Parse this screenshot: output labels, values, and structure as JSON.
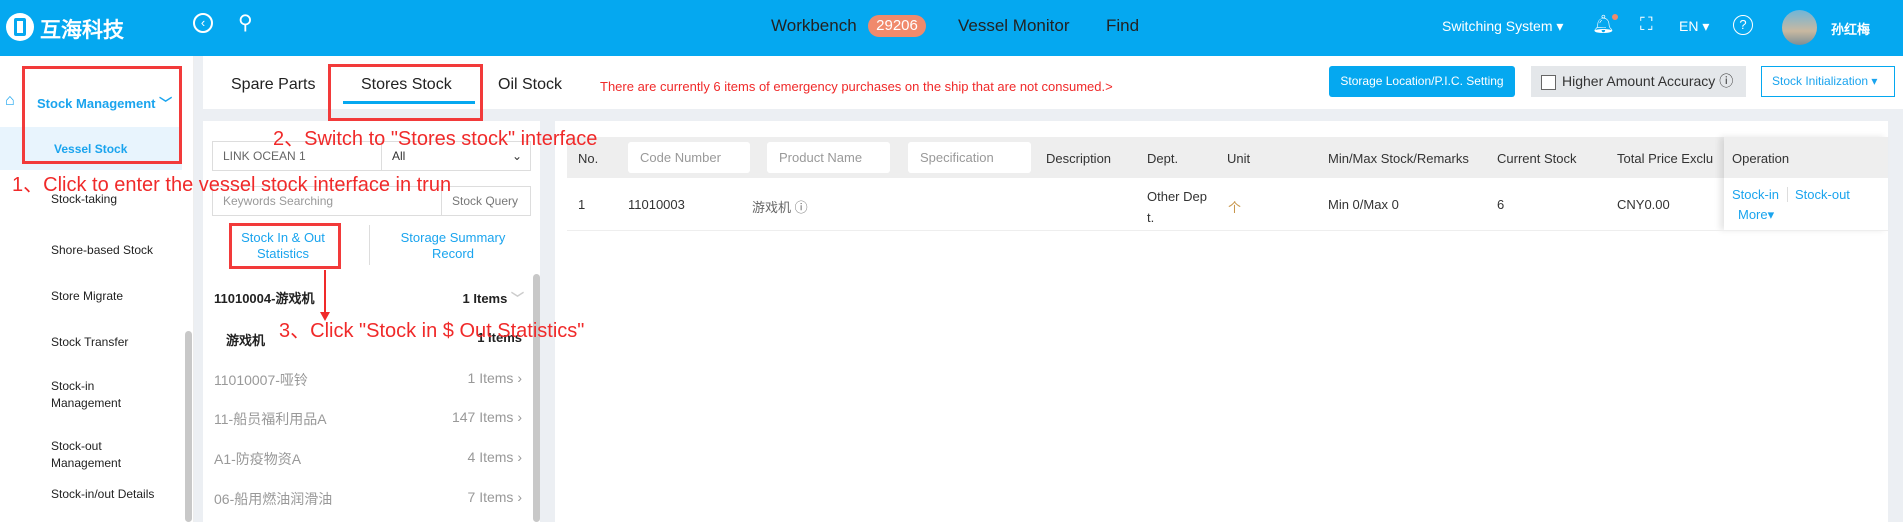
{
  "header": {
    "brand": "互海科技",
    "nav": {
      "workbench": "Workbench",
      "workbench_badge": "29206",
      "vessel_monitor": "Vessel Monitor",
      "find": "Find"
    },
    "switching_system": "Switching System",
    "language": "EN",
    "user_name": "孙红梅"
  },
  "sidebar": {
    "group": "Stock Management",
    "items": [
      {
        "label": "Vessel Stock",
        "active": true
      },
      {
        "label": "Stock-taking"
      },
      {
        "label": "Shore-based Stock"
      },
      {
        "label": "Store Migrate"
      },
      {
        "label": "Stock Transfer"
      },
      {
        "label": "Stock-in Management"
      },
      {
        "label": "Stock-out Management"
      },
      {
        "label": "Stock-in/out Details"
      }
    ]
  },
  "tabs": [
    {
      "label": "Spare Parts"
    },
    {
      "label": "Stores Stock",
      "active": true
    },
    {
      "label": "Oil Stock"
    }
  ],
  "notice": "There are currently 6 items of emergency purchases on the ship that are not consumed.>",
  "toolbar": {
    "storage_setting": "Storage Location/P.I.C. Setting",
    "higher_accuracy": "Higher Amount Accuracy",
    "stock_init": "Stock Initialization"
  },
  "left": {
    "vessel": "LINK OCEAN 1",
    "filter": "All",
    "keyword_placeholder": "Keywords Searching",
    "stock_query": "Stock Query",
    "stats_link": "Stock In & Out Statistics",
    "summary_link": "Storage Summary Record",
    "groups": [
      {
        "name": "11010004-游戏机",
        "count": "1 Items",
        "expanded": true,
        "children": [
          {
            "name": "游戏机",
            "count": "1 Items"
          }
        ]
      },
      {
        "name": "11010007-哑铃",
        "count": "1 Items"
      },
      {
        "name": "11-船员福利用品A",
        "count": "147 Items"
      },
      {
        "name": "A1-防疫物资A",
        "count": "4 Items"
      },
      {
        "name": "06-船用燃油润滑油",
        "count": "7 Items"
      }
    ]
  },
  "table": {
    "headers": {
      "no": "No.",
      "code": "Code Number",
      "product": "Product Name",
      "spec": "Specification",
      "desc": "Description",
      "dept": "Dept.",
      "unit": "Unit",
      "minmax": "Min/Max Stock/Remarks",
      "current": "Current Stock",
      "total": "Total Price Exclu",
      "operation": "Operation"
    },
    "rows": [
      {
        "no": "1",
        "code": "11010003",
        "product": "游戏机",
        "desc": "",
        "dept": "Other Dept.",
        "unit": "个",
        "minmax": "Min 0/Max 0",
        "current": "6",
        "total": "CNY0.00",
        "ops": {
          "stock_in": "Stock-in",
          "stock_out": "Stock-out",
          "more": "More"
        }
      }
    ]
  },
  "annotations": {
    "step1": "1、Click to enter the vessel stock interface in trun",
    "step2": "2、Switch to \"Stores stock\" interface",
    "step3": "3、Click \"Stock in $ Out Statistics\""
  },
  "colors": {
    "header": "#05a8f0",
    "annotation": "#f02a2a",
    "link": "#1aa4ee",
    "badge": "#f08a6c"
  }
}
